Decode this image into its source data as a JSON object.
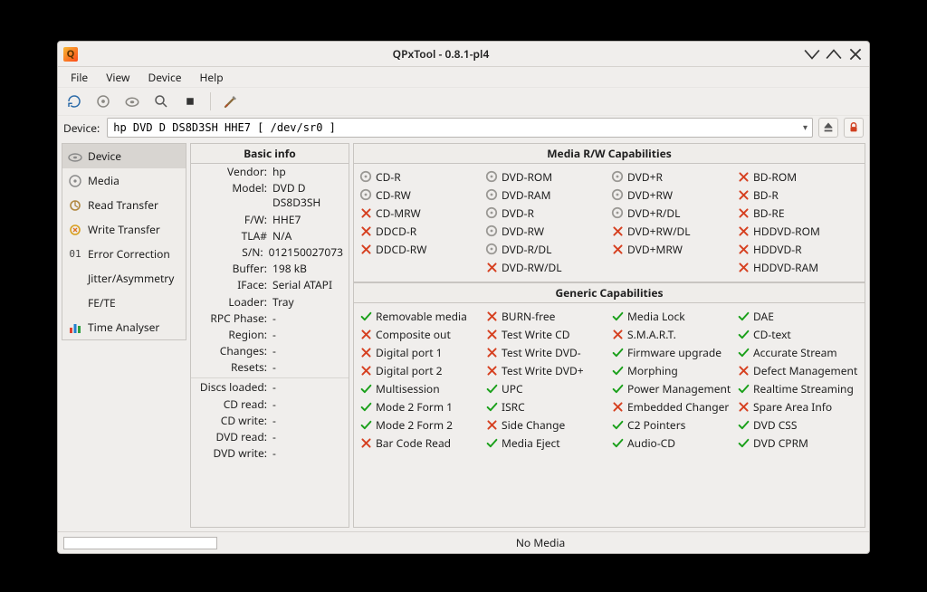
{
  "window_title": "QPxTool - 0.8.1-pl4",
  "menu": [
    "File",
    "View",
    "Device",
    "Help"
  ],
  "device_label": "Device:",
  "device_value": "hp      DVD D  DS8D3SH   HHE7 [ /dev/sr0 ]",
  "sidebar": {
    "items": [
      {
        "label": "Device"
      },
      {
        "label": "Media"
      },
      {
        "label": "Read Transfer"
      },
      {
        "label": "Write Transfer"
      },
      {
        "label": "Error Correction"
      },
      {
        "label": "Jitter/Asymmetry"
      },
      {
        "label": "FE/TE"
      },
      {
        "label": "Time Analyser"
      }
    ]
  },
  "basic": {
    "title": "Basic info",
    "rows": [
      {
        "k": "Vendor:",
        "v": "hp"
      },
      {
        "k": "Model:",
        "v": "DVD D  DS8D3SH"
      },
      {
        "k": "F/W:",
        "v": "HHE7"
      },
      {
        "k": "TLA#",
        "v": "N/A"
      },
      {
        "k": "S/N:",
        "v": "012150027073"
      },
      {
        "k": "Buffer:",
        "v": "198 kB"
      },
      {
        "k": "IFace:",
        "v": "Serial ATAPI"
      },
      {
        "k": "Loader:",
        "v": "Tray"
      },
      {
        "k": "RPC Phase:",
        "v": "-"
      },
      {
        "k": "Region:",
        "v": "-"
      },
      {
        "k": "Changes:",
        "v": "-"
      },
      {
        "k": "Resets:",
        "v": "-"
      },
      {
        "k": "Discs loaded:",
        "v": "-",
        "sep": true
      },
      {
        "k": "CD read:",
        "v": "-"
      },
      {
        "k": "CD write:",
        "v": "-"
      },
      {
        "k": "DVD read:",
        "v": "-"
      },
      {
        "k": "DVD write:",
        "v": "-"
      }
    ]
  },
  "media_caps": {
    "title": "Media R/W Capabilities",
    "cols": [
      [
        {
          "t": "CD-R",
          "s": "disc"
        },
        {
          "t": "CD-RW",
          "s": "disc"
        },
        {
          "t": "CD-MRW",
          "s": "no"
        },
        {
          "t": "DDCD-R",
          "s": "no"
        },
        {
          "t": "DDCD-RW",
          "s": "no"
        }
      ],
      [
        {
          "t": "DVD-ROM",
          "s": "disc"
        },
        {
          "t": "DVD-RAM",
          "s": "disc"
        },
        {
          "t": "DVD-R",
          "s": "disc"
        },
        {
          "t": "DVD-RW",
          "s": "disc"
        },
        {
          "t": "DVD-R/DL",
          "s": "disc"
        },
        {
          "t": "DVD-RW/DL",
          "s": "no"
        }
      ],
      [
        {
          "t": "DVD+R",
          "s": "disc"
        },
        {
          "t": "DVD+RW",
          "s": "disc"
        },
        {
          "t": "DVD+R/DL",
          "s": "disc"
        },
        {
          "t": "DVD+RW/DL",
          "s": "no"
        },
        {
          "t": "DVD+MRW",
          "s": "no"
        }
      ],
      [
        {
          "t": "BD-ROM",
          "s": "no"
        },
        {
          "t": "BD-R",
          "s": "no"
        },
        {
          "t": "BD-RE",
          "s": "no"
        },
        {
          "t": "HDDVD-ROM",
          "s": "no"
        },
        {
          "t": "HDDVD-R",
          "s": "no"
        },
        {
          "t": "HDDVD-RAM",
          "s": "no"
        }
      ]
    ]
  },
  "generic_caps": {
    "title": "Generic Capabilities",
    "cols": [
      [
        {
          "t": "Removable media",
          "s": "ok"
        },
        {
          "t": "Composite out",
          "s": "no"
        },
        {
          "t": "Digital port 1",
          "s": "no"
        },
        {
          "t": "Digital port 2",
          "s": "no"
        },
        {
          "t": "Multisession",
          "s": "ok"
        },
        {
          "t": "Mode 2 Form 1",
          "s": "ok"
        },
        {
          "t": "Mode 2 Form 2",
          "s": "ok"
        },
        {
          "t": "Bar Code Read",
          "s": "no"
        }
      ],
      [
        {
          "t": "BURN-free",
          "s": "no"
        },
        {
          "t": "Test Write CD",
          "s": "no"
        },
        {
          "t": "Test Write DVD-",
          "s": "no"
        },
        {
          "t": "Test Write DVD+",
          "s": "no"
        },
        {
          "t": "UPC",
          "s": "ok"
        },
        {
          "t": "ISRC",
          "s": "ok"
        },
        {
          "t": "Side Change",
          "s": "no"
        },
        {
          "t": "Media Eject",
          "s": "ok"
        }
      ],
      [
        {
          "t": "Media Lock",
          "s": "ok"
        },
        {
          "t": "S.M.A.R.T.",
          "s": "no"
        },
        {
          "t": "Firmware upgrade",
          "s": "ok"
        },
        {
          "t": "Morphing",
          "s": "ok"
        },
        {
          "t": "Power Management",
          "s": "ok"
        },
        {
          "t": "Embedded Changer",
          "s": "no"
        },
        {
          "t": "C2 Pointers",
          "s": "ok"
        },
        {
          "t": "Audio-CD",
          "s": "ok"
        }
      ],
      [
        {
          "t": "DAE",
          "s": "ok"
        },
        {
          "t": "CD-text",
          "s": "ok"
        },
        {
          "t": "Accurate Stream",
          "s": "ok"
        },
        {
          "t": "Defect Management",
          "s": "no"
        },
        {
          "t": "Realtime Streaming",
          "s": "ok"
        },
        {
          "t": "Spare Area Info",
          "s": "no"
        },
        {
          "t": "DVD CSS",
          "s": "ok"
        },
        {
          "t": "DVD CPRM",
          "s": "ok"
        }
      ]
    ]
  },
  "status_text": "No Media"
}
